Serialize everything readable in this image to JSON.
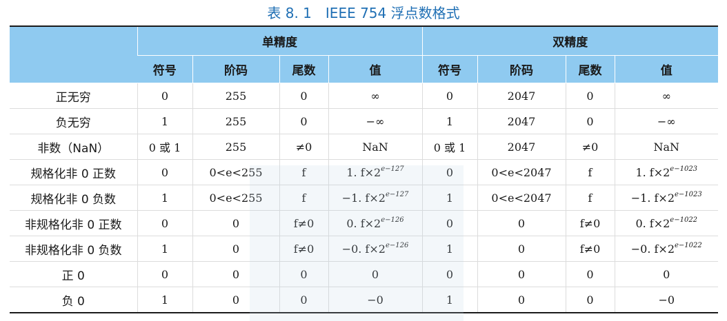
{
  "caption": "表 8. 1　IEEE 754 浮点数格式",
  "groups": {
    "single": "单精度",
    "double": "双精度"
  },
  "columns": [
    "符号",
    "阶码",
    "尾数",
    "值"
  ],
  "rows": [
    {
      "name": "正无穷",
      "s_sign": "0",
      "s_exp": "255",
      "s_frac": "0",
      "s_val": "∞",
      "d_sign": "0",
      "d_exp": "2047",
      "d_frac": "0",
      "d_val": "∞"
    },
    {
      "name": "负无穷",
      "s_sign": "1",
      "s_exp": "255",
      "s_frac": "0",
      "s_val": "−∞",
      "d_sign": "1",
      "d_exp": "2047",
      "d_frac": "0",
      "d_val": "−∞"
    },
    {
      "name": "非数（NaN）",
      "s_sign": "0 或 1",
      "s_exp": "255",
      "s_frac": "≠0",
      "s_val": "NaN",
      "d_sign": "0 或 1",
      "d_exp": "2047",
      "d_frac": "≠0",
      "d_val": "NaN"
    },
    {
      "name": "规格化非 0 正数",
      "s_sign": "0",
      "s_exp": "0<e<255",
      "s_frac": "f",
      "s_val": "1. f×2",
      "s_val_exp": "e−127",
      "d_sign": "0",
      "d_exp": "0<e<2047",
      "d_frac": "f",
      "d_val": "1. f×2",
      "d_val_exp": "e−1023"
    },
    {
      "name": "规格化非 0 负数",
      "s_sign": "1",
      "s_exp": "0<e<255",
      "s_frac": "f",
      "s_val": "−1. f×2",
      "s_val_exp": "e−127",
      "d_sign": "1",
      "d_exp": "0<e<2047",
      "d_frac": "f",
      "d_val": "−1. f×2",
      "d_val_exp": "e−1023"
    },
    {
      "name": "非规格化非 0 正数",
      "s_sign": "0",
      "s_exp": "0",
      "s_frac": "f≠0",
      "s_val": "0. f×2",
      "s_val_exp": "e−126",
      "d_sign": "0",
      "d_exp": "0",
      "d_frac": "f≠0",
      "d_val": "0. f×2",
      "d_val_exp": "e−1022"
    },
    {
      "name": "非规格化非 0 负数",
      "s_sign": "1",
      "s_exp": "0",
      "s_frac": "f≠0",
      "s_val": "−0. f×2",
      "s_val_exp": "e−126",
      "d_sign": "1",
      "d_exp": "0",
      "d_frac": "f≠0",
      "d_val": "−0. f×2",
      "d_val_exp": "e−1022"
    },
    {
      "name": "正 0",
      "s_sign": "0",
      "s_exp": "0",
      "s_frac": "0",
      "s_val": "0",
      "d_sign": "0",
      "d_exp": "0",
      "d_frac": "0",
      "d_val": "0"
    },
    {
      "name": "负 0",
      "s_sign": "1",
      "s_exp": "0",
      "s_frac": "0",
      "s_val": "−0",
      "d_sign": "1",
      "d_exp": "0",
      "d_frac": "0",
      "d_val": "−0"
    }
  ],
  "colors": {
    "caption": "#1f6fb4",
    "header_bg": "#8fcaf0"
  }
}
